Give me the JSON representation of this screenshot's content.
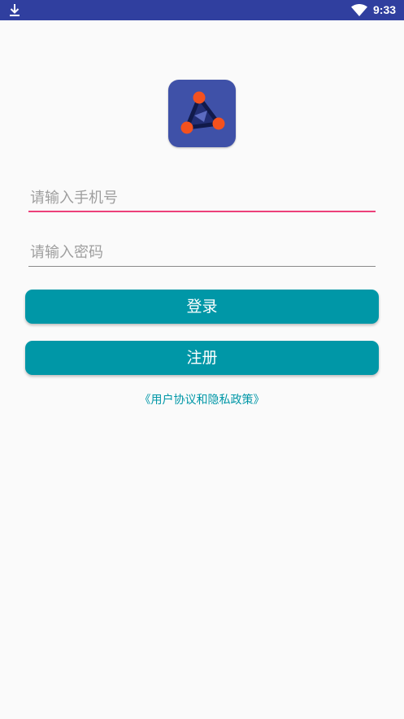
{
  "status_bar": {
    "time": "9:33",
    "icons": [
      "download-icon",
      "wifi-icon"
    ],
    "background": "#303f9f"
  },
  "logo": {
    "icon": "app-logo-icon",
    "background": "#3f51a8",
    "dot_color": "#f4511e"
  },
  "form": {
    "phone_placeholder": "请输入手机号",
    "phone_value": "",
    "password_placeholder": "请输入密码",
    "password_value": "",
    "focus_color": "#e91e63"
  },
  "buttons": {
    "login_label": "登录",
    "register_label": "注册",
    "color": "#0097a7"
  },
  "agreement_link": "《用户协议和隐私政策》"
}
